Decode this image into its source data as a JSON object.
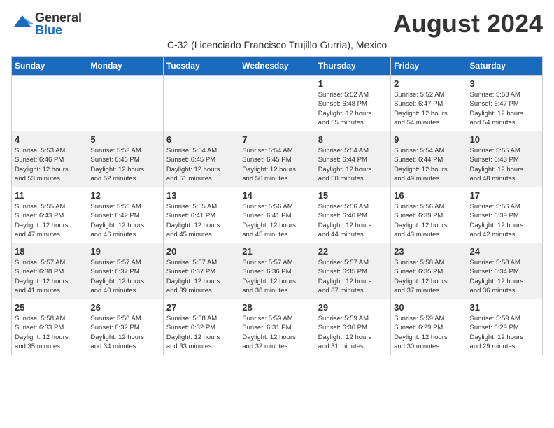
{
  "header": {
    "logo_general": "General",
    "logo_blue": "Blue",
    "title": "August 2024",
    "subtitle": "C-32 (Licenciado Francisco Trujillo Gurria), Mexico"
  },
  "days_of_week": [
    "Sunday",
    "Monday",
    "Tuesday",
    "Wednesday",
    "Thursday",
    "Friday",
    "Saturday"
  ],
  "weeks": [
    [
      {
        "day": "",
        "info": ""
      },
      {
        "day": "",
        "info": ""
      },
      {
        "day": "",
        "info": ""
      },
      {
        "day": "",
        "info": ""
      },
      {
        "day": "1",
        "info": "Sunrise: 5:52 AM\nSunset: 6:48 PM\nDaylight: 12 hours\nand 55 minutes."
      },
      {
        "day": "2",
        "info": "Sunrise: 5:52 AM\nSunset: 6:47 PM\nDaylight: 12 hours\nand 54 minutes."
      },
      {
        "day": "3",
        "info": "Sunrise: 5:53 AM\nSunset: 6:47 PM\nDaylight: 12 hours\nand 54 minutes."
      }
    ],
    [
      {
        "day": "4",
        "info": "Sunrise: 5:53 AM\nSunset: 6:46 PM\nDaylight: 12 hours\nand 53 minutes."
      },
      {
        "day": "5",
        "info": "Sunrise: 5:53 AM\nSunset: 6:46 PM\nDaylight: 12 hours\nand 52 minutes."
      },
      {
        "day": "6",
        "info": "Sunrise: 5:54 AM\nSunset: 6:45 PM\nDaylight: 12 hours\nand 51 minutes."
      },
      {
        "day": "7",
        "info": "Sunrise: 5:54 AM\nSunset: 6:45 PM\nDaylight: 12 hours\nand 50 minutes."
      },
      {
        "day": "8",
        "info": "Sunrise: 5:54 AM\nSunset: 6:44 PM\nDaylight: 12 hours\nand 50 minutes."
      },
      {
        "day": "9",
        "info": "Sunrise: 5:54 AM\nSunset: 6:44 PM\nDaylight: 12 hours\nand 49 minutes."
      },
      {
        "day": "10",
        "info": "Sunrise: 5:55 AM\nSunset: 6:43 PM\nDaylight: 12 hours\nand 48 minutes."
      }
    ],
    [
      {
        "day": "11",
        "info": "Sunrise: 5:55 AM\nSunset: 6:43 PM\nDaylight: 12 hours\nand 47 minutes."
      },
      {
        "day": "12",
        "info": "Sunrise: 5:55 AM\nSunset: 6:42 PM\nDaylight: 12 hours\nand 46 minutes."
      },
      {
        "day": "13",
        "info": "Sunrise: 5:55 AM\nSunset: 6:41 PM\nDaylight: 12 hours\nand 45 minutes."
      },
      {
        "day": "14",
        "info": "Sunrise: 5:56 AM\nSunset: 6:41 PM\nDaylight: 12 hours\nand 45 minutes."
      },
      {
        "day": "15",
        "info": "Sunrise: 5:56 AM\nSunset: 6:40 PM\nDaylight: 12 hours\nand 44 minutes."
      },
      {
        "day": "16",
        "info": "Sunrise: 5:56 AM\nSunset: 6:39 PM\nDaylight: 12 hours\nand 43 minutes."
      },
      {
        "day": "17",
        "info": "Sunrise: 5:56 AM\nSunset: 6:39 PM\nDaylight: 12 hours\nand 42 minutes."
      }
    ],
    [
      {
        "day": "18",
        "info": "Sunrise: 5:57 AM\nSunset: 6:38 PM\nDaylight: 12 hours\nand 41 minutes."
      },
      {
        "day": "19",
        "info": "Sunrise: 5:57 AM\nSunset: 6:37 PM\nDaylight: 12 hours\nand 40 minutes."
      },
      {
        "day": "20",
        "info": "Sunrise: 5:57 AM\nSunset: 6:37 PM\nDaylight: 12 hours\nand 39 minutes."
      },
      {
        "day": "21",
        "info": "Sunrise: 5:57 AM\nSunset: 6:36 PM\nDaylight: 12 hours\nand 38 minutes."
      },
      {
        "day": "22",
        "info": "Sunrise: 5:57 AM\nSunset: 6:35 PM\nDaylight: 12 hours\nand 37 minutes."
      },
      {
        "day": "23",
        "info": "Sunrise: 5:58 AM\nSunset: 6:35 PM\nDaylight: 12 hours\nand 37 minutes."
      },
      {
        "day": "24",
        "info": "Sunrise: 5:58 AM\nSunset: 6:34 PM\nDaylight: 12 hours\nand 36 minutes."
      }
    ],
    [
      {
        "day": "25",
        "info": "Sunrise: 5:58 AM\nSunset: 6:33 PM\nDaylight: 12 hours\nand 35 minutes."
      },
      {
        "day": "26",
        "info": "Sunrise: 5:58 AM\nSunset: 6:32 PM\nDaylight: 12 hours\nand 34 minutes."
      },
      {
        "day": "27",
        "info": "Sunrise: 5:58 AM\nSunset: 6:32 PM\nDaylight: 12 hours\nand 33 minutes."
      },
      {
        "day": "28",
        "info": "Sunrise: 5:59 AM\nSunset: 6:31 PM\nDaylight: 12 hours\nand 32 minutes."
      },
      {
        "day": "29",
        "info": "Sunrise: 5:59 AM\nSunset: 6:30 PM\nDaylight: 12 hours\nand 31 minutes."
      },
      {
        "day": "30",
        "info": "Sunrise: 5:59 AM\nSunset: 6:29 PM\nDaylight: 12 hours\nand 30 minutes."
      },
      {
        "day": "31",
        "info": "Sunrise: 5:59 AM\nSunset: 6:29 PM\nDaylight: 12 hours\nand 29 minutes."
      }
    ]
  ]
}
